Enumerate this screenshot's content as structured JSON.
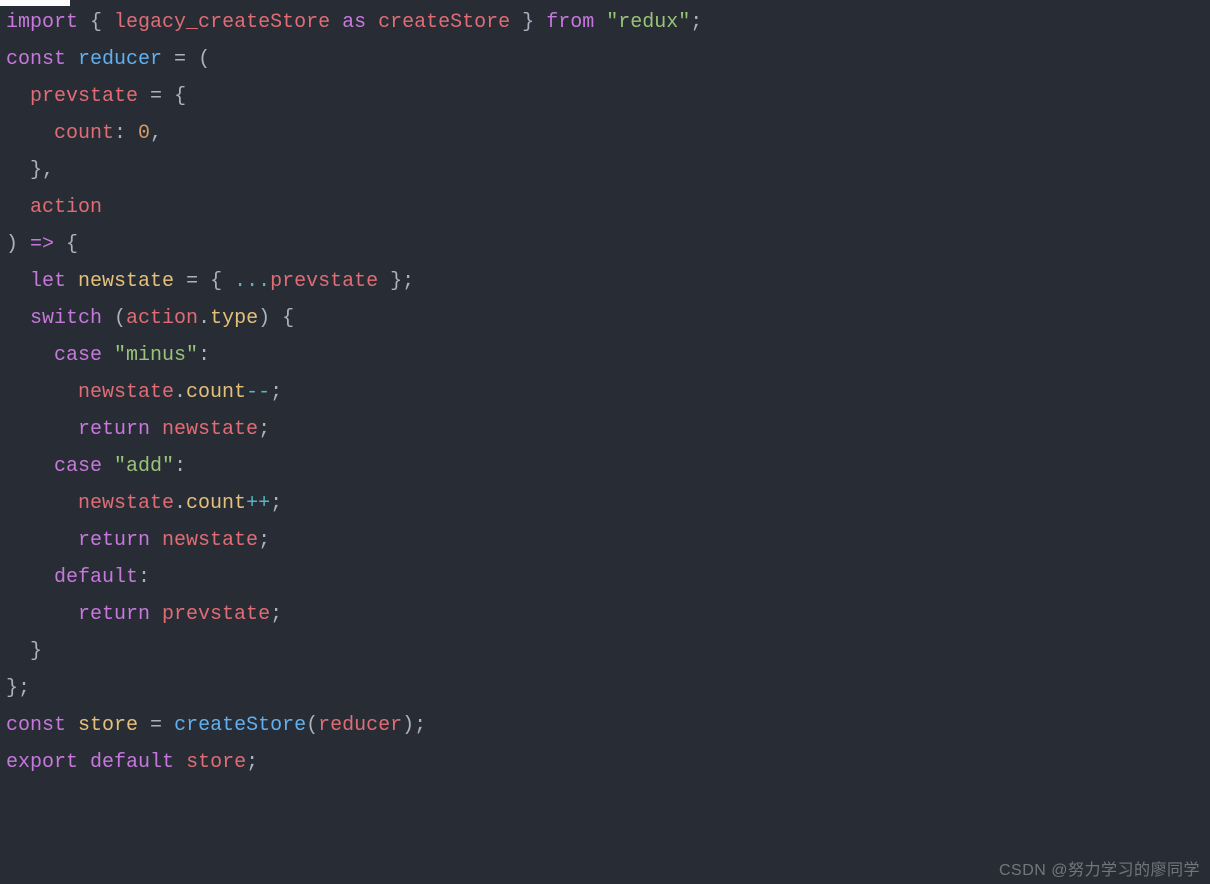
{
  "colors": {
    "background": "#282c34",
    "default": "#abb2bf",
    "keyword": "#c678dd",
    "ident": "#e06c75",
    "varname": "#e5c07b",
    "func": "#61afef",
    "number": "#d19a66",
    "string": "#98c379",
    "operator": "#56b6c2"
  },
  "watermark": "CSDN @努力学习的廖同学",
  "code": {
    "l1": {
      "kw_import": "import",
      "brace_open": "{ ",
      "legacy": "legacy_createStore",
      "kw_as": "as",
      "createStore": "createStore",
      "brace_close": " }",
      "kw_from": "from",
      "str_redux": "\"redux\"",
      "semi": ";"
    },
    "l2": {
      "kw_const": "const",
      "reducer": "reducer",
      "eq": " = ",
      "paren": "("
    },
    "l3": {
      "indent": "  ",
      "prevstate": "prevstate",
      "eq": " = ",
      "brace": "{"
    },
    "l4": {
      "indent": "    ",
      "count": "count",
      "colon": ": ",
      "zero": "0",
      "comma": ","
    },
    "l5": {
      "indent": "  ",
      "brace": "}",
      "comma": ","
    },
    "l6": {
      "indent": "  ",
      "action": "action"
    },
    "l7": {
      "paren": ") ",
      "arrow": "=>",
      "brace": " {"
    },
    "l8": {
      "indent": "  ",
      "kw_let": "let",
      "sp": " ",
      "newstate": "newstate",
      "eq": " = ",
      "open": "{ ",
      "spread": "...",
      "prevstate": "prevstate",
      "close": " }",
      "semi": ";"
    },
    "l9": {
      "indent": "  ",
      "kw_switch": "switch",
      "sp": " (",
      "action": "action",
      "dot": ".",
      "type": "type",
      "close": ") {"
    },
    "l10": {
      "indent": "    ",
      "kw_case": "case",
      "sp": " ",
      "str": "\"minus\"",
      "colon": ":"
    },
    "l11": {
      "indent": "      ",
      "newstate": "newstate",
      "dot": ".",
      "count": "count",
      "op": "--",
      "semi": ";"
    },
    "l12": {
      "indent": "      ",
      "kw_return": "return",
      "sp": " ",
      "newstate": "newstate",
      "semi": ";"
    },
    "l13": {
      "indent": "    ",
      "kw_case": "case",
      "sp": " ",
      "str": "\"add\"",
      "colon": ":"
    },
    "l14": {
      "indent": "      ",
      "newstate": "newstate",
      "dot": ".",
      "count": "count",
      "op": "++",
      "semi": ";"
    },
    "l15": {
      "indent": "      ",
      "kw_return": "return",
      "sp": " ",
      "newstate": "newstate",
      "semi": ";"
    },
    "l16": {
      "indent": "    ",
      "kw_default": "default",
      "colon": ":"
    },
    "l17": {
      "indent": "      ",
      "kw_return": "return",
      "sp": " ",
      "prevstate": "prevstate",
      "semi": ";"
    },
    "l18": {
      "indent": "  ",
      "brace": "}"
    },
    "l19": {
      "brace": "}",
      "semi": ";"
    },
    "l20": {
      "kw_const": "const",
      "sp": " ",
      "store": "store",
      "eq": " = ",
      "createStore": "createStore",
      "open": "(",
      "reducer": "reducer",
      "close": ")",
      "semi": ";"
    },
    "l21": {
      "kw_export": "export",
      "sp": " ",
      "kw_default": "default",
      "sp2": " ",
      "store": "store",
      "semi": ";"
    }
  }
}
